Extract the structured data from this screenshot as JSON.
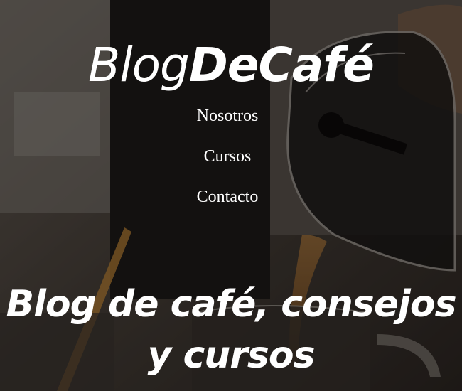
{
  "header": {
    "logo_part1": "Blog",
    "logo_part2": "DeCafé"
  },
  "nav": {
    "items": [
      {
        "label": "Nosotros"
      },
      {
        "label": "Cursos"
      },
      {
        "label": "Contacto"
      }
    ]
  },
  "hero": {
    "headline": "Blog de café, consejos y cursos"
  }
}
